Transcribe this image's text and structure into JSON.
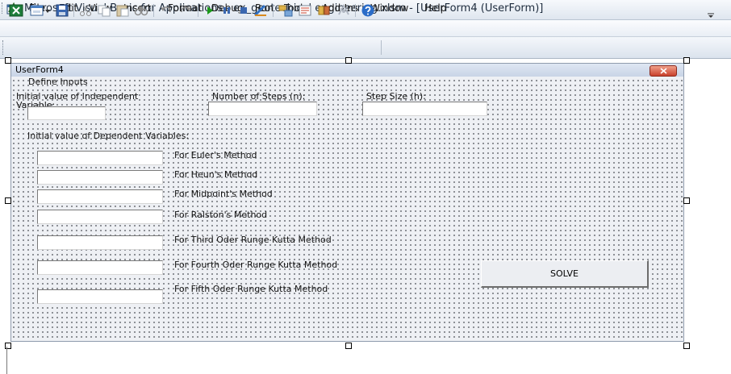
{
  "window": {
    "title": "Microsoft Visual Basic for Applications - ex_geotechical engineering.xlsm - [UserForm4 (UserForm)]"
  },
  "menu": [
    "File",
    "Edit",
    "View",
    "Insert",
    "Format",
    "Debug",
    "Run",
    "Tools",
    "Add-Ins",
    "Window",
    "Help"
  ],
  "toolbar_icons": [
    "view-excel-icon",
    "insert-userform-icon",
    "save-icon",
    "cut-icon",
    "copy-icon",
    "paste-icon",
    "find-icon",
    "undo-icon",
    "redo-icon",
    "run-icon",
    "break-icon",
    "reset-icon",
    "design-mode-icon",
    "project-explorer-icon",
    "properties-icon",
    "object-browser-icon",
    "toolbox-icon",
    "help-icon"
  ],
  "form": {
    "caption": "UserForm4",
    "define_inputs": "Define Inputs",
    "initial_independent": "Initial value of Independent\nVariable:",
    "steps": "Number of Steps (n):",
    "step_size": "Step Size (h):",
    "dependent_header": "Initial value of Dependent Variables:",
    "methods": [
      "For Euler's Method",
      "For Heun's Method",
      "For Midpoint's Method",
      "For Ralston's Method",
      "For Third Oder Runge Kutta Method",
      "For Fourth Oder Runge Kutta Method",
      "For Fifth Oder Runge Kutta Method"
    ],
    "solve": "SOLVE"
  },
  "colors": {
    "titlebar": "#dfe6ef",
    "form_bg": "#eef0f4",
    "close_red": "#c9412c",
    "run_green": "#1a9a1a",
    "help_blue": "#2a6cc8"
  }
}
